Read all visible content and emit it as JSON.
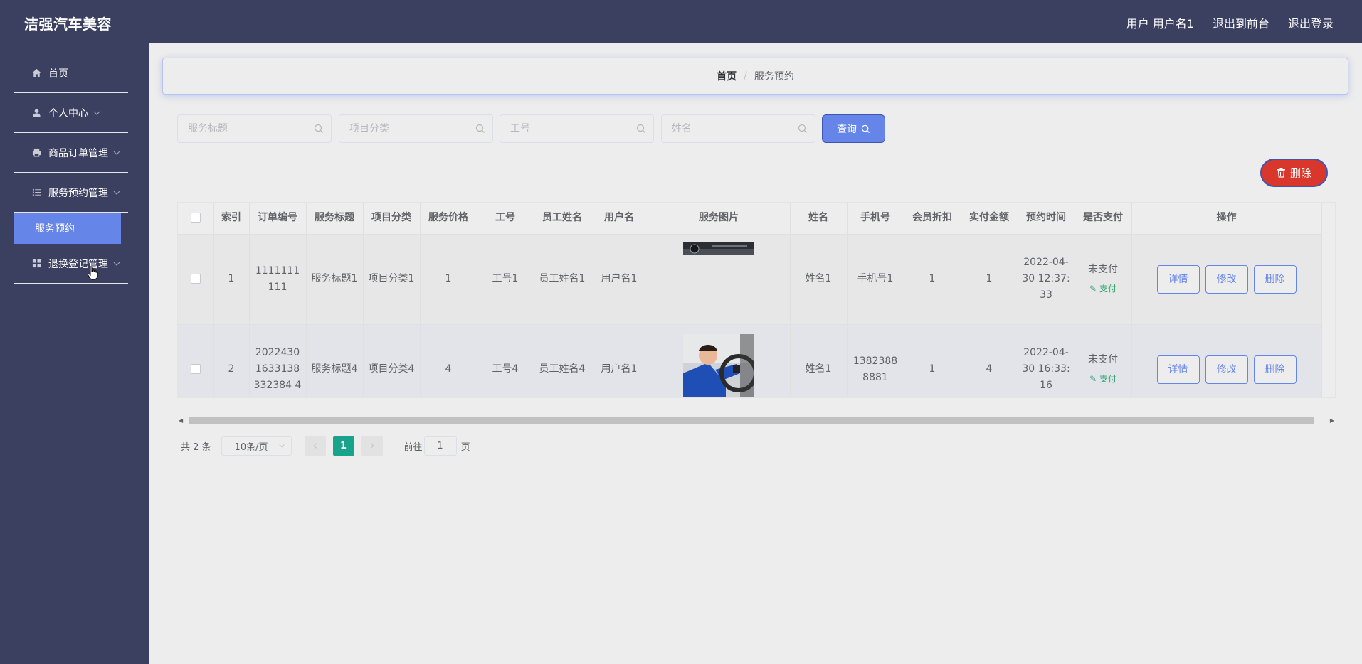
{
  "header": {
    "brand": "洁强汽车美容",
    "user_label": "用户 用户名1",
    "to_front": "退出到前台",
    "logout": "退出登录"
  },
  "sidebar": {
    "items": [
      {
        "label": "首页",
        "icon": "home-icon"
      },
      {
        "label": "个人中心",
        "icon": "user-icon"
      },
      {
        "label": "商品订单管理",
        "icon": "printer-icon"
      },
      {
        "label": "服务预约管理",
        "icon": "list-icon"
      },
      {
        "label": "退换登记管理",
        "icon": "grid-icon"
      }
    ],
    "active_sub": "服务预约"
  },
  "breadcrumb": {
    "home": "首页",
    "sep": "/",
    "current": "服务预约"
  },
  "search": {
    "title_placeholder": "服务标题",
    "category_placeholder": "项目分类",
    "worker_no_placeholder": "工号",
    "name_placeholder": "姓名",
    "query_label": "查询"
  },
  "toolbar": {
    "delete_label": "删除"
  },
  "table": {
    "headers": [
      "索引",
      "订单编号",
      "服务标题",
      "项目分类",
      "服务价格",
      "工号",
      "员工姓名",
      "用户名",
      "服务图片",
      "姓名",
      "手机号",
      "会员折扣",
      "实付金额",
      "预约时间",
      "是否支付",
      "操作"
    ],
    "rows": [
      {
        "index": "1",
        "order_no": "1111111111",
        "title": "服务标题1",
        "category": "项目分类1",
        "price": "1",
        "worker_no": "工号1",
        "worker_name": "员工姓名1",
        "username": "用户名1",
        "name": "姓名1",
        "phone": "手机号1",
        "discount": "1",
        "paid": "1",
        "time": "2022-04-30 12:37:33",
        "pay_status": "未支付",
        "pay_link": "支付"
      },
      {
        "index": "2",
        "order_no": "20224301633138332384 4",
        "title": "服务标题4",
        "category": "项目分类4",
        "price": "4",
        "worker_no": "工号4",
        "worker_name": "员工姓名4",
        "username": "用户名1",
        "name": "姓名1",
        "phone": "13823888881",
        "discount": "1",
        "paid": "4",
        "time": "2022-04-30 16:33:16",
        "pay_status": "未支付",
        "pay_link": "支付"
      }
    ],
    "actions": {
      "detail": "详情",
      "edit": "修改",
      "delete": "删除"
    }
  },
  "pagination": {
    "total": "共 2 条",
    "page_size": "10条/页",
    "current_page": "1",
    "goto_label": "前往",
    "goto_value": "1",
    "page_suffix": "页"
  },
  "colors": {
    "sidebar_bg": "#3c4060",
    "accent": "#6585e9",
    "danger": "#d9372b",
    "page_active": "#17a38c"
  }
}
